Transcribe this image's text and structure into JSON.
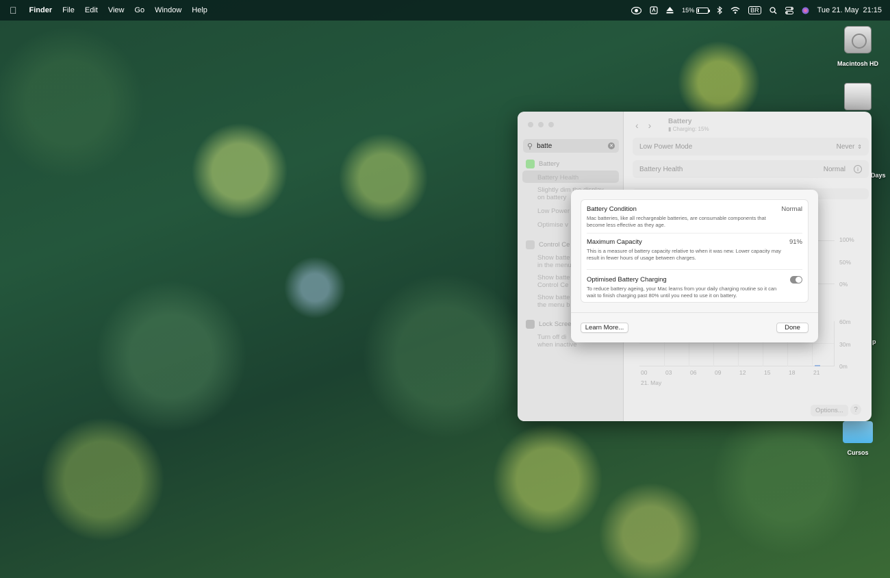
{
  "menubar": {
    "app": "Finder",
    "menus": [
      "File",
      "Edit",
      "View",
      "Go",
      "Window",
      "Help"
    ],
    "battery_percent": "15%",
    "battery_fraction": 0.15,
    "keyboard_layout": "BR",
    "clock": "Tue 21. May  21:15",
    "icons": [
      "apple-icon",
      "screen-share-icon",
      "app-status-icon",
      "eject-icon",
      "battery-icon",
      "bluetooth-icon",
      "wifi-icon",
      "keyboard-icon",
      "spotlight-icon",
      "control-center-icon",
      "siri-icon"
    ]
  },
  "desktop": {
    "icons": [
      {
        "label": "Macintosh HD",
        "icon": "hard-disk-icon"
      },
      {
        "label": "",
        "icon": "external-drive-icon"
      },
      {
        "label": "Cursos",
        "icon": "folder-icon"
      }
    ],
    "edge_labels": [
      "Days",
      "p"
    ]
  },
  "settings": {
    "search": {
      "value": "batte"
    },
    "sidebar": {
      "battery": "Battery",
      "battery_health": "Battery Health",
      "slightly_dim_1": "Slightly dim the display",
      "slightly_dim_2": "on battery",
      "low_power": "Low Power",
      "optimise": "Optimise v",
      "control_centre": "Control Ce",
      "show_bat_1a": "Show batte",
      "show_bat_1b": "in the menu",
      "show_bat_2a": "Show batte",
      "show_bat_2b": "Control Ce",
      "show_bat_3a": "Show batte",
      "show_bat_3b": "the menu b",
      "lock_screen": "Lock Scree",
      "turn_off_1": "Turn off di",
      "turn_off_2": "when inactive"
    },
    "pane": {
      "title": "Battery",
      "subtitle": "Charging: 15%",
      "low_power_mode": {
        "label": "Low Power Mode",
        "value": "Never"
      },
      "battery_health": {
        "label": "Battery Health",
        "value": "Normal"
      },
      "chart_y_pct": [
        "100%",
        "50%",
        "0%"
      ],
      "chart_y_min": [
        "60m",
        "30m",
        "0m"
      ],
      "chart_x": [
        "00",
        "03",
        "06",
        "09",
        "12",
        "15",
        "18",
        "21"
      ],
      "chart_date": "21. May",
      "options_button": "Options...",
      "help_button": "?"
    }
  },
  "dialog": {
    "condition": {
      "title": "Battery Condition",
      "value": "Normal",
      "desc": "Mac batteries, like all rechargeable batteries, are consumable components that become less effective as they age."
    },
    "capacity": {
      "title": "Maximum Capacity",
      "value": "91%",
      "desc": "This is a measure of battery capacity relative to when it was new. Lower capacity may result in fewer hours of usage between charges."
    },
    "optimised": {
      "title": "Optimised Battery Charging",
      "enabled": true,
      "desc": "To reduce battery ageing, your Mac learns from your daily charging routine so it can wait to finish charging past 80% until you need to use it on battery."
    },
    "learn_more": "Learn More...",
    "done": "Done"
  }
}
